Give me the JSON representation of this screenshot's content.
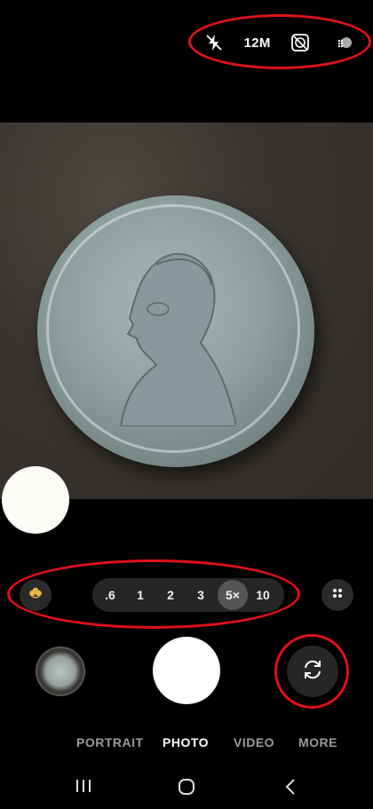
{
  "top_bar": {
    "icons": [
      "flash-off-icon",
      "timer-off-icon",
      "settings-dots-icon"
    ],
    "resolution_label": "12M"
  },
  "zoom": {
    "options": [
      ".6",
      "1",
      "2",
      "3",
      "5×",
      "10"
    ],
    "selected": "5×"
  },
  "modes": {
    "items": [
      "PORTRAIT",
      "PHOTO",
      "VIDEO",
      "MORE"
    ],
    "selected": "PHOTO"
  },
  "nav_bar": {
    "icons": [
      "recents-icon",
      "home-icon",
      "back-icon"
    ]
  },
  "colors": {
    "annotation_red": "#e0101a",
    "background": "#000000"
  }
}
